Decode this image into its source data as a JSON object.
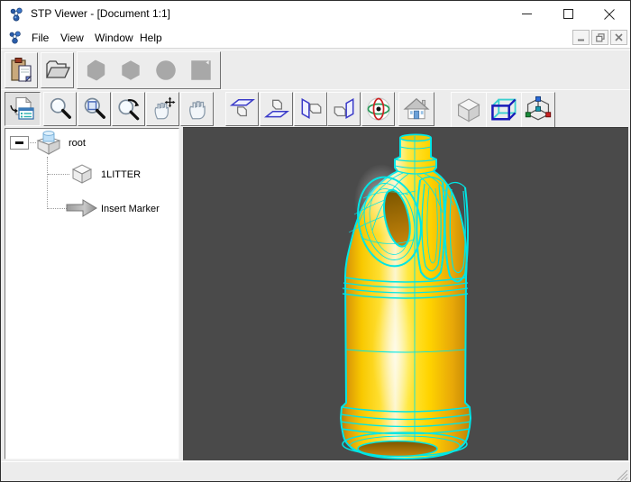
{
  "window": {
    "title": "STP Viewer - [Document 1:1]"
  },
  "titlebar": {
    "controls": [
      {
        "name": "minimize",
        "glyph": "–"
      },
      {
        "name": "maximize",
        "glyph": "□"
      },
      {
        "name": "close",
        "glyph": "✕"
      }
    ]
  },
  "menu": {
    "items": [
      "File",
      "View",
      "Window",
      "Help"
    ],
    "mdi_controls": [
      {
        "name": "mdi-minimize",
        "glyph": "_"
      },
      {
        "name": "mdi-restore",
        "glyph": "🗗"
      },
      {
        "name": "mdi-close",
        "glyph": "×"
      }
    ]
  },
  "toolbars": {
    "standard": {
      "buttons": [
        {
          "icon": "paste-icon",
          "enabled": true
        },
        {
          "icon": "open-file-icon",
          "enabled": true
        },
        {
          "icon": "solid-shaded-icon",
          "enabled": false
        },
        {
          "icon": "solid-box-icon",
          "enabled": false
        },
        {
          "icon": "sphere-icon",
          "enabled": false
        },
        {
          "icon": "plane-icon",
          "enabled": false
        }
      ]
    },
    "view": {
      "buttons": [
        {
          "icon": "model-tree-toggle-icon",
          "pressed": true
        },
        {
          "icon": "zoom-icon"
        },
        {
          "icon": "zoom-window-icon"
        },
        {
          "icon": "zoom-dynamic-icon"
        },
        {
          "icon": "pan-icon"
        },
        {
          "icon": "rotate-hand-icon"
        },
        {
          "icon": "view-top-icon"
        },
        {
          "icon": "view-bottom-icon"
        },
        {
          "icon": "view-left-icon"
        },
        {
          "icon": "view-right-icon"
        },
        {
          "icon": "orbit-icon"
        },
        {
          "icon": "home-view-icon"
        },
        {
          "icon": "shaded-mode-icon"
        },
        {
          "icon": "wireframe-mode-icon"
        },
        {
          "icon": "axonometric-view-icon"
        }
      ]
    }
  },
  "tree": {
    "items": [
      {
        "label": "root",
        "icon": "assembly-icon",
        "level": 0,
        "expanded": true
      },
      {
        "label": "1LITTER",
        "icon": "part-icon",
        "level": 1
      },
      {
        "label": "Insert Marker",
        "icon": "insert-marker-icon",
        "level": 1
      }
    ]
  },
  "viewport": {
    "background_color": "#4a4a4a",
    "model": "1-litre plastic bottle",
    "body_color": "#ffd400",
    "edge_color": "#00e5e5"
  },
  "statusbar": {
    "text": ""
  }
}
